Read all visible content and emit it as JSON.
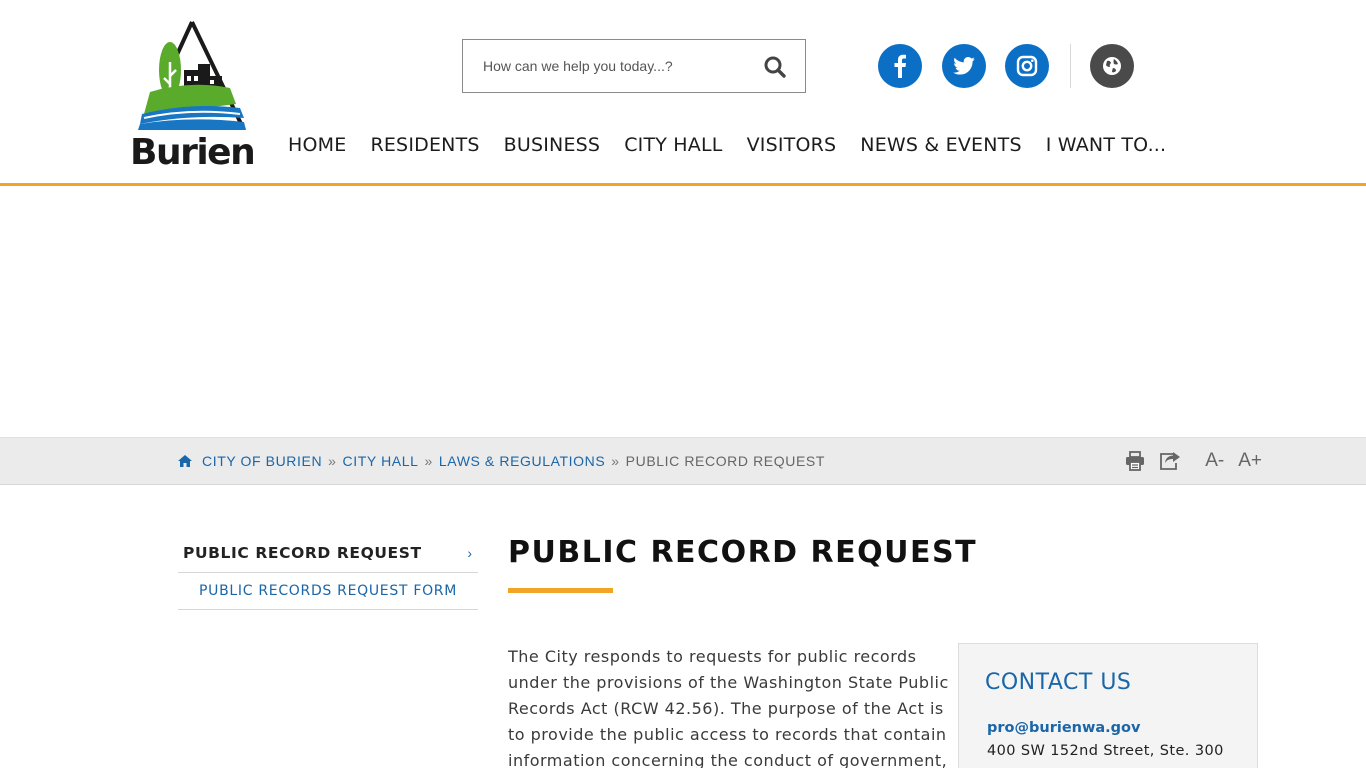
{
  "header": {
    "logo_text": "Burien",
    "search": {
      "placeholder": "How can we help you today...?",
      "value": ""
    },
    "social": [
      {
        "icon": "facebook-icon"
      },
      {
        "icon": "twitter-icon"
      },
      {
        "icon": "instagram-icon"
      },
      {
        "icon": "globe-icon"
      }
    ],
    "nav": [
      {
        "label": "HOME"
      },
      {
        "label": "RESIDENTS"
      },
      {
        "label": "BUSINESS"
      },
      {
        "label": "CITY HALL"
      },
      {
        "label": "VISITORS"
      },
      {
        "label": "NEWS & EVENTS"
      },
      {
        "label": "I WANT TO..."
      }
    ]
  },
  "breadcrumb": {
    "items": [
      {
        "label": "CITY OF BURIEN"
      },
      {
        "label": "CITY HALL"
      },
      {
        "label": "LAWS & REGULATIONS"
      }
    ],
    "separator": "»",
    "current": "PUBLIC RECORD REQUEST",
    "tools": {
      "font_decrease": "A-",
      "font_increase": "A+"
    }
  },
  "sidebar": {
    "main_item": "PUBLIC RECORD REQUEST",
    "chevron": "›",
    "sub_items": [
      {
        "label": "PUBLIC RECORDS REQUEST FORM"
      }
    ]
  },
  "main": {
    "title": "PUBLIC RECORD REQUEST",
    "paragraph": "The City responds to requests for public records under the provisions of the Washington State Public Records Act (RCW 42.56). The purpose of the Act is to provide the public access to records that contain information concerning the conduct of government,"
  },
  "contact": {
    "heading": "CONTACT US",
    "email": "pro@burienwa.gov",
    "address": "400 SW 152nd Street, Ste. 300"
  },
  "colors": {
    "brand_blue": "#0c6fc6",
    "link_blue": "#1a66a8",
    "accent_orange": "#f0a524",
    "logo_green": "#5aaa2b",
    "logo_blue": "#1876c2"
  }
}
